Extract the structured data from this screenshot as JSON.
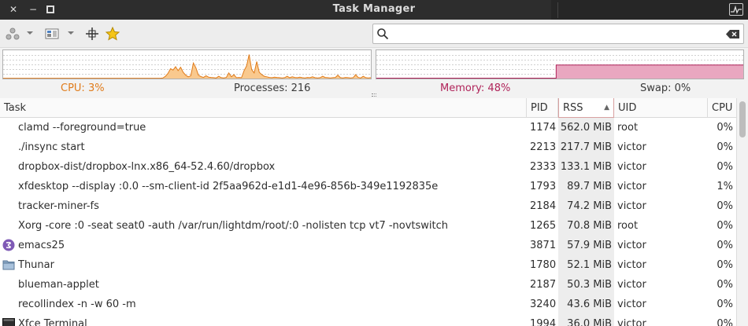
{
  "window": {
    "title": "Task Manager"
  },
  "search": {
    "value": "",
    "placeholder": ""
  },
  "status": {
    "cpu": "CPU: 3%",
    "processes": "Processes: 216",
    "memory": "Memory: 48%",
    "swap": "Swap: 0%"
  },
  "colors": {
    "cpu": "#e07b1a",
    "memory": "#b0245a"
  },
  "table": {
    "columns": [
      "Task",
      "PID",
      "RSS",
      "UID",
      "CPU"
    ],
    "sorted_column": "RSS",
    "rows": [
      {
        "task": "clamd --foreground=true",
        "pid": "1174",
        "rss": "562.0 MiB",
        "uid": "root",
        "cpu": "0%",
        "icon": ""
      },
      {
        "task": "./insync start",
        "pid": "2213",
        "rss": "217.7 MiB",
        "uid": "victor",
        "cpu": "0%",
        "icon": ""
      },
      {
        "task": "dropbox-dist/dropbox-lnx.x86_64-52.4.60/dropbox",
        "pid": "2333",
        "rss": "133.1 MiB",
        "uid": "victor",
        "cpu": "0%",
        "icon": ""
      },
      {
        "task": "xfdesktop --display :0.0 --sm-client-id 2f5aa962d-e1d1-4e96-856b-349e1192835e",
        "pid": "1793",
        "rss": "89.7 MiB",
        "uid": "victor",
        "cpu": "1%",
        "icon": ""
      },
      {
        "task": "tracker-miner-fs",
        "pid": "2184",
        "rss": "74.2 MiB",
        "uid": "victor",
        "cpu": "0%",
        "icon": ""
      },
      {
        "task": "Xorg -core :0 -seat seat0 -auth /var/run/lightdm/root/:0 -nolisten tcp vt7 -novtswitch",
        "pid": "1265",
        "rss": "70.8 MiB",
        "uid": "root",
        "cpu": "0%",
        "icon": ""
      },
      {
        "task": "emacs25",
        "pid": "3871",
        "rss": "57.9 MiB",
        "uid": "victor",
        "cpu": "0%",
        "icon": "emacs-icon"
      },
      {
        "task": "Thunar",
        "pid": "1780",
        "rss": "52.1 MiB",
        "uid": "victor",
        "cpu": "0%",
        "icon": "folder-icon"
      },
      {
        "task": "blueman-applet",
        "pid": "2187",
        "rss": "50.3 MiB",
        "uid": "victor",
        "cpu": "0%",
        "icon": ""
      },
      {
        "task": "recollindex -n -w 60 -m",
        "pid": "3240",
        "rss": "43.6 MiB",
        "uid": "victor",
        "cpu": "0%",
        "icon": ""
      },
      {
        "task": "Xfce Terminal",
        "pid": "1994",
        "rss": "36.0 MiB",
        "uid": "victor",
        "cpu": "0%",
        "icon": "terminal-icon"
      }
    ]
  },
  "graphs": {
    "cpu_history": [
      1,
      1,
      1,
      1,
      1,
      1,
      1,
      1,
      1,
      1,
      1,
      1,
      1,
      1,
      1,
      1,
      1,
      1,
      1,
      1,
      1,
      1,
      1,
      1,
      1,
      1,
      1,
      1,
      1,
      1,
      1,
      1,
      1,
      1,
      1,
      1,
      1,
      1,
      1,
      1,
      1,
      1,
      1,
      1,
      1,
      1,
      1,
      1,
      1,
      1,
      1,
      1,
      1,
      1,
      1,
      1,
      1,
      1,
      1,
      1,
      1,
      1,
      1,
      2,
      8,
      18,
      35,
      30,
      42,
      28,
      40,
      22,
      12,
      6,
      10,
      55,
      38,
      12,
      7,
      4,
      10,
      5,
      4,
      3,
      2,
      8,
      3,
      2,
      4,
      20,
      6,
      14,
      3,
      4,
      3,
      28,
      45,
      85,
      32,
      20,
      60,
      22,
      14,
      8,
      6,
      4,
      3,
      5,
      4,
      3,
      2,
      3,
      8,
      3,
      6,
      4,
      3,
      5,
      3,
      2,
      4,
      3,
      6,
      3,
      2,
      3,
      8,
      4,
      3,
      2,
      3,
      4,
      12,
      3,
      2,
      4,
      3,
      2,
      3,
      14,
      4,
      2,
      8,
      3,
      2,
      3
    ],
    "memory_percent": 48,
    "memory_history_start": 0.49
  }
}
